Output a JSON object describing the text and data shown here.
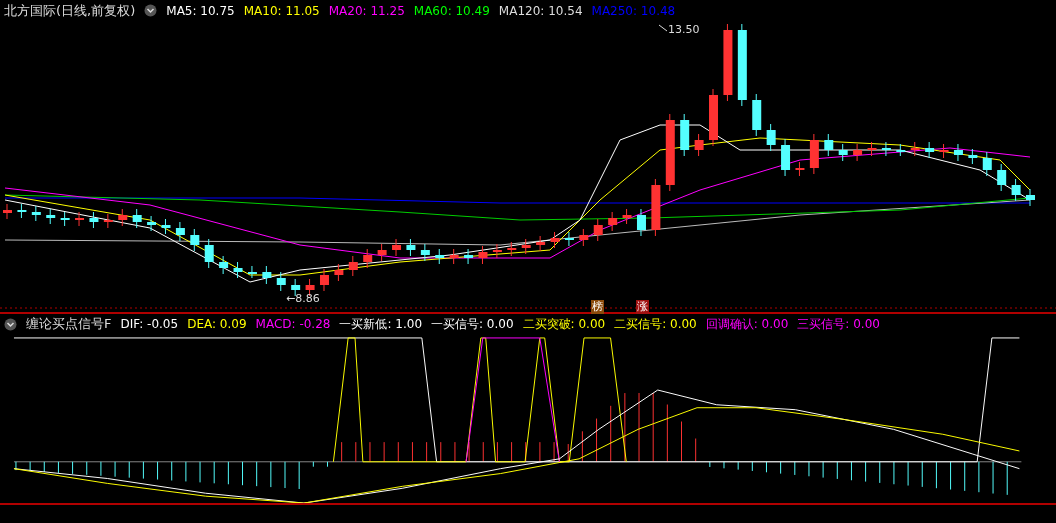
{
  "main_panel": {
    "title": "北方国际(日线,前复权)",
    "indicators": [
      {
        "label": "MA5: 10.75",
        "color": "#ffffff"
      },
      {
        "label": "MA10: 11.05",
        "color": "#ffff00"
      },
      {
        "label": "MA20: 11.25",
        "color": "#ff00ff"
      },
      {
        "label": "MA60: 10.49",
        "color": "#00ff00"
      },
      {
        "label": "MA120: 10.54",
        "color": "#dddddd"
      },
      {
        "label": "MA250: 10.48",
        "color": "#0000ff"
      }
    ],
    "high_label": "13.50",
    "low_label": "←8.86",
    "badges": [
      {
        "text": "榜",
        "color": "#8b4a0a"
      },
      {
        "text": "涨",
        "color": "#a01010"
      }
    ]
  },
  "indicator_panel": {
    "title": "缠论买点信号F",
    "indicators": [
      {
        "label": "DIF: -0.05",
        "color": "#ffffff"
      },
      {
        "label": "DEA: 0.09",
        "color": "#ffff00"
      },
      {
        "label": "MACD: -0.28",
        "color": "#ff00ff"
      },
      {
        "label": "一买新低: 1.00",
        "color": "#ffffff"
      },
      {
        "label": "一买信号: 0.00",
        "color": "#ffffff"
      },
      {
        "label": "二买突破: 0.00",
        "color": "#ffff00"
      },
      {
        "label": "二买信号: 0.00",
        "color": "#ffff00"
      },
      {
        "label": "回调确认: 0.00",
        "color": "#ff00ff"
      },
      {
        "label": "三买信号: 0.00",
        "color": "#ff00ff"
      }
    ]
  }
}
